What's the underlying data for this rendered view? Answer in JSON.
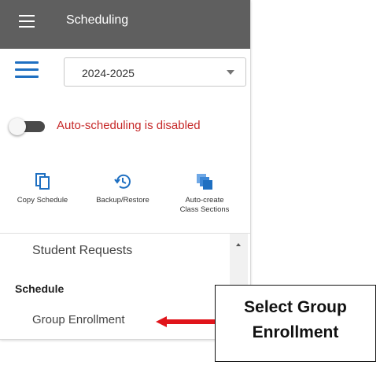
{
  "header": {
    "title": "Scheduling"
  },
  "school_year": {
    "selected": "2024-2025"
  },
  "auto_scheduling": {
    "status": "Auto-scheduling is disabled",
    "enabled": false,
    "status_color": "#c62828"
  },
  "actions": [
    {
      "label": "Copy Schedule",
      "icon": "copy-icon"
    },
    {
      "label": "Backup/Restore",
      "icon": "history-icon"
    },
    {
      "label_line1": "Auto-create",
      "label_line2": "Class Sections",
      "icon": "stack-icon"
    }
  ],
  "nav": {
    "item_requests": "Student Requests",
    "section_schedule": "Schedule",
    "item_group_enrollment": "Group Enrollment"
  },
  "callout": {
    "line1": "Select Group",
    "line2": "Enrollment"
  },
  "colors": {
    "accent": "#1e6fc1",
    "header_bg": "#5f5f5f",
    "arrow": "#e0151b"
  }
}
